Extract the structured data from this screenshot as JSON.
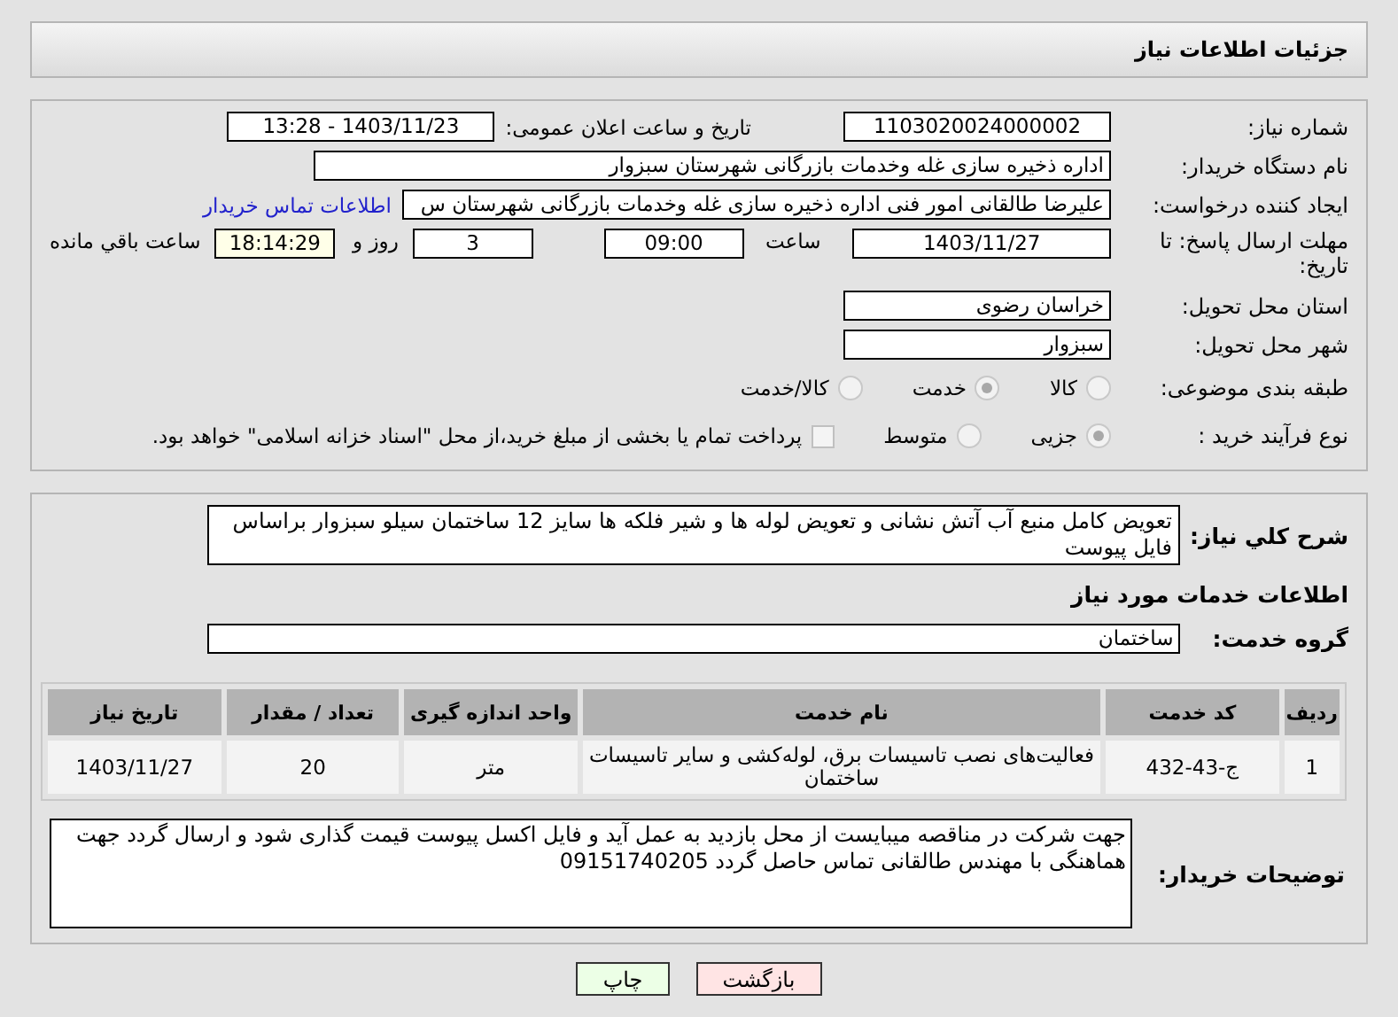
{
  "page_title": "جزئیات اطلاعات نیاز",
  "need_number": {
    "label": "شماره نیاز:",
    "value": "1103020024000002"
  },
  "announce": {
    "label": "تاریخ و ساعت اعلان عمومی:",
    "value": "1403/11/23 - 13:28"
  },
  "buyer_org": {
    "label": "نام دستگاه خریدار:",
    "value": "اداره ذخیره سازی غله وخدمات بازرگانی شهرستان سبزوار"
  },
  "requester": {
    "label": "ایجاد کننده درخواست:",
    "value": "علیرضا طالقانی امور فنی اداره ذخیره سازی غله وخدمات بازرگانی شهرستان س",
    "link": "اطلاعات تماس خریدار"
  },
  "deadline": {
    "label": "مهلت ارسال پاسخ: تا تاریخ:",
    "date": "1403/11/27",
    "time_label": "ساعت",
    "time": "09:00",
    "days": "3",
    "days_label": "روز و",
    "remaining": "18:14:29",
    "remaining_label": "ساعت باقي مانده"
  },
  "province": {
    "label": "استان محل تحویل:",
    "value": "خراسان رضوی"
  },
  "city": {
    "label": "شهر محل تحویل:",
    "value": "سبزوار"
  },
  "category": {
    "label": "طبقه بندی موضوعی:",
    "options": [
      {
        "label": "کالا",
        "selected": false
      },
      {
        "label": "خدمت",
        "selected": true
      },
      {
        "label": "کالا/خدمت",
        "selected": false
      }
    ]
  },
  "purchase_type": {
    "label": "نوع فرآیند خرید :",
    "options": [
      {
        "label": "جزیی",
        "selected": true
      },
      {
        "label": "متوسط",
        "selected": false
      }
    ],
    "treasury": {
      "label": "پرداخت تمام یا بخشی از مبلغ خرید،از محل \"اسناد خزانه اسلامی\" خواهد بود.",
      "checked": false
    }
  },
  "description": {
    "label": "شرح کلي نیاز:",
    "value": "تعویض کامل منبع آب آتش نشانی و تعویض لوله ها و شیر فلکه ها سایز 12 ساختمان سیلو سبزوار براساس فایل پیوست"
  },
  "services_heading": "اطلاعات خدمات مورد نیاز",
  "service_group": {
    "label": "گروه خدمت:",
    "value": "ساختمان"
  },
  "table": {
    "columns": [
      "ردیف",
      "کد خدمت",
      "نام خدمت",
      "واحد اندازه گیری",
      "تعداد / مقدار",
      "تاریخ نیاز"
    ],
    "rows": [
      [
        "1",
        "ج-43-432",
        "فعالیت‌های نصب تاسیسات برق، لوله‌کشی و سایر تاسیسات ساختمان",
        "متر",
        "20",
        "1403/11/27"
      ]
    ]
  },
  "buyer_notes": {
    "label": "توضیحات خریدار:",
    "value": "جهت شرکت در مناقصه میبایست از محل بازدید به عمل آید و فایل اکسل پیوست قیمت گذاری شود و ارسال گردد جهت هماهنگی با مهندس طالقانی تماس حاصل گردد 09151740205"
  },
  "buttons": [
    {
      "label": "بازگشت",
      "kind": "back"
    },
    {
      "label": "چاپ",
      "kind": "print"
    }
  ]
}
